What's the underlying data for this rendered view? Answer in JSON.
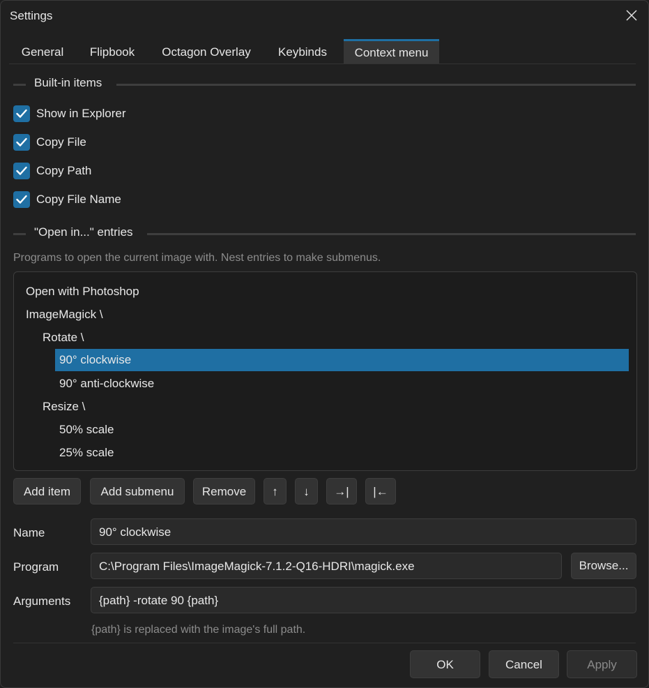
{
  "window": {
    "title": "Settings"
  },
  "tabs": [
    {
      "label": "General"
    },
    {
      "label": "Flipbook"
    },
    {
      "label": "Octagon Overlay"
    },
    {
      "label": "Keybinds"
    },
    {
      "label": "Context menu",
      "active": true
    }
  ],
  "builtin": {
    "heading": "Built-in items",
    "items": [
      {
        "label": "Show in Explorer",
        "checked": true
      },
      {
        "label": "Copy File",
        "checked": true
      },
      {
        "label": "Copy Path",
        "checked": true
      },
      {
        "label": "Copy File Name",
        "checked": true
      }
    ]
  },
  "open_in": {
    "heading": "\"Open in...\" entries",
    "description": "Programs to open the current image with. Nest entries to make submenus.",
    "entries": [
      {
        "label": "Open with Photoshop",
        "depth": 0
      },
      {
        "label": "ImageMagick  \\",
        "depth": 0
      },
      {
        "label": "Rotate  \\",
        "depth": 1
      },
      {
        "label": "90° clockwise",
        "depth": 2,
        "selected": true
      },
      {
        "label": "90° anti-clockwise",
        "depth": 2
      },
      {
        "label": "Resize  \\",
        "depth": 1
      },
      {
        "label": "50% scale",
        "depth": 2
      },
      {
        "label": "25% scale",
        "depth": 2
      }
    ]
  },
  "toolbar": {
    "add_item": "Add item",
    "add_submenu": "Add submenu",
    "remove": "Remove",
    "move_up": "↑",
    "move_down": "↓",
    "indent": "→|",
    "outdent": "|←"
  },
  "form": {
    "name_label": "Name",
    "name_value": "90° clockwise",
    "program_label": "Program",
    "program_value": "C:\\Program Files\\ImageMagick-7.1.2-Q16-HDRI\\magick.exe",
    "browse": "Browse...",
    "arguments_label": "Arguments",
    "arguments_value": "{path} -rotate 90 {path}",
    "arguments_hint": "{path} is replaced with the image's full path."
  },
  "footer": {
    "ok": "OK",
    "cancel": "Cancel",
    "apply": "Apply"
  },
  "colors": {
    "accent": "#1f6fa3",
    "background": "#202020"
  }
}
